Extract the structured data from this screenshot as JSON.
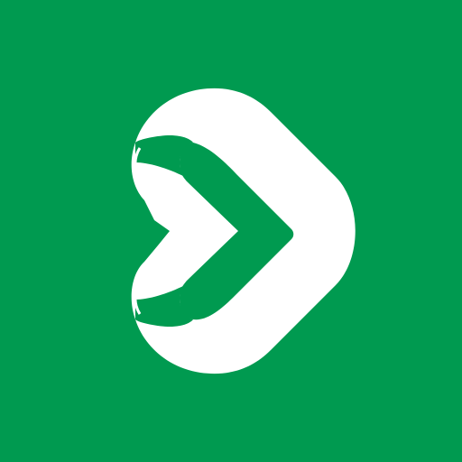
{
  "app_icon": {
    "icon": "heart-play-logo-icon",
    "colors": {
      "background": "#009a50",
      "foreground": "#ffffff"
    }
  }
}
